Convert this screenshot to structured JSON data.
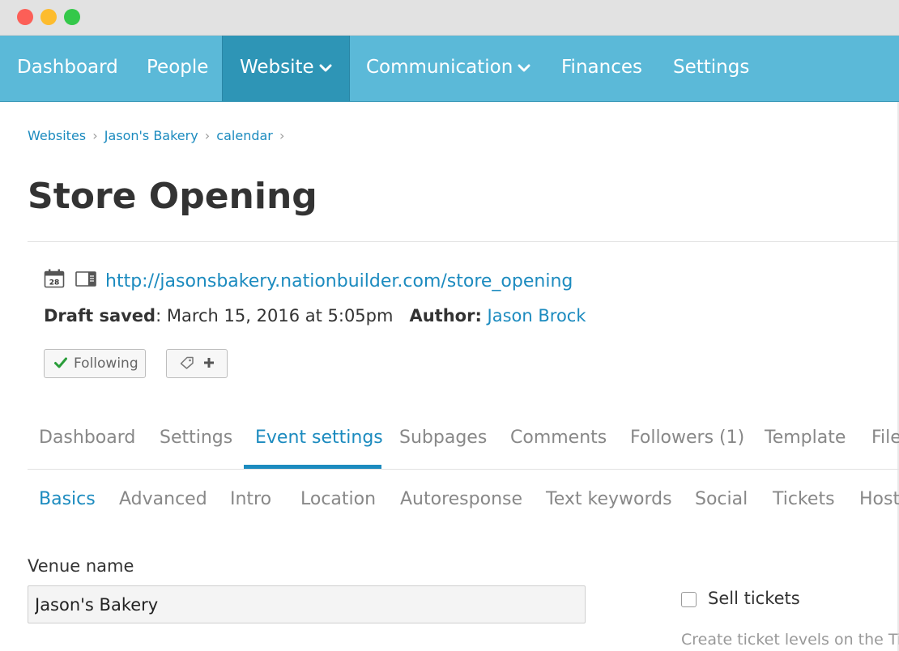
{
  "nav": {
    "items": [
      {
        "label": "Dashboard"
      },
      {
        "label": "People"
      },
      {
        "label": "Website"
      },
      {
        "label": "Communication"
      },
      {
        "label": "Finances"
      },
      {
        "label": "Settings"
      }
    ],
    "active": "Website",
    "accent": "#5bb9d8",
    "active_color": "#2e95b6"
  },
  "breadcrumb": [
    "Websites",
    "Jason's Bakery",
    "calendar"
  ],
  "page": {
    "title": "Store Opening",
    "url": "http://jasonsbakery.nationbuilder.com/store_opening",
    "calendar_icon_day": "28",
    "draft_label": "Draft saved",
    "draft_value": ": March 15, 2016 at 5:05pm",
    "author_label": "Author:",
    "author_name": "Jason Brock"
  },
  "buttons": {
    "following": "Following",
    "tag_icon": "tag-icon",
    "add_icon": "plus-icon"
  },
  "tabs": [
    "Dashboard",
    "Settings",
    "Event settings",
    "Subpages",
    "Comments",
    "Followers (1)",
    "Template",
    "File"
  ],
  "active_tab": "Event settings",
  "subtabs": [
    "Basics",
    "Advanced",
    "Intro",
    "Location",
    "Autoresponse",
    "Text keywords",
    "Social",
    "Tickets",
    "Host"
  ],
  "active_subtab": "Basics",
  "form": {
    "venue_label": "Venue name",
    "venue_value": "Jason's Bakery",
    "sell_tickets_label": "Sell tickets",
    "sell_tickets_checked": false,
    "ticket_help": "Create ticket levels on the Tic"
  },
  "colors": {
    "link": "#1c8bbf",
    "check": "#2a9d3a"
  }
}
